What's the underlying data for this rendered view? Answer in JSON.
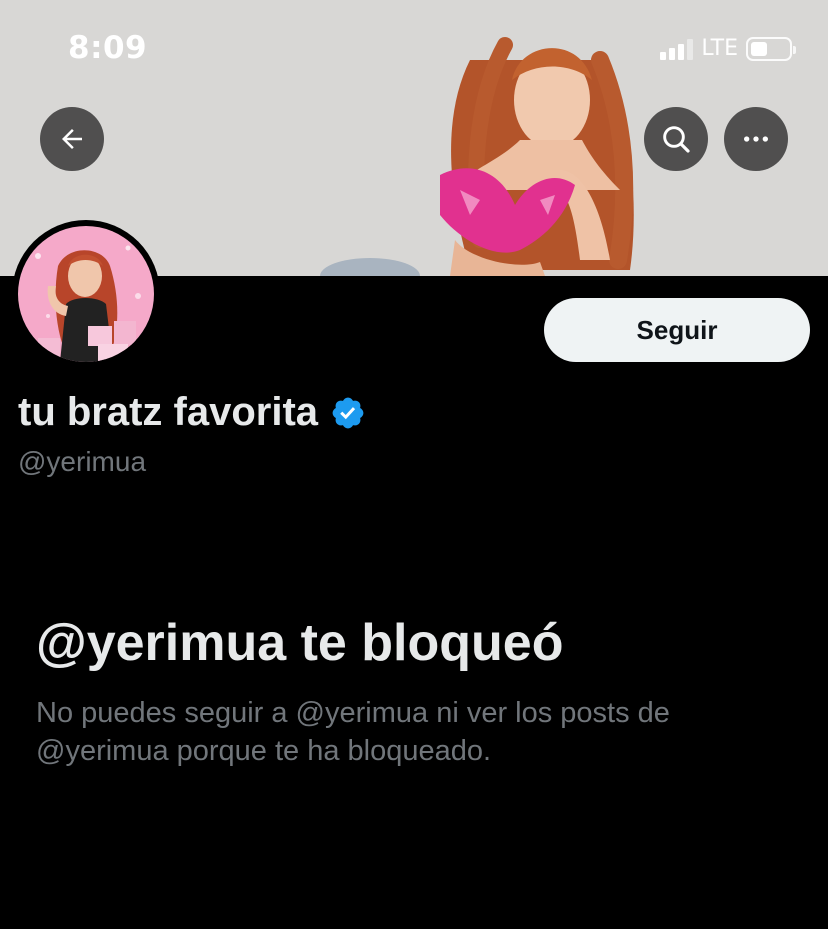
{
  "status_bar": {
    "time": "8:09",
    "network": "LTE",
    "signal_bars_active": 3,
    "signal_bars_total": 4,
    "battery_level": 0.45
  },
  "nav": {
    "back_icon": "arrow-left-icon",
    "search_icon": "search-icon",
    "more_icon": "more-horizontal-icon"
  },
  "profile": {
    "display_name": "tu bratz favorita",
    "verified_icon": "verified-badge-icon",
    "verified_color": "#1d9bf0",
    "handle": "@yerimua"
  },
  "actions": {
    "follow_label": "Seguir"
  },
  "blocked": {
    "title": "@yerimua te bloqueó",
    "description": "No puedes seguir a @yerimua ni ver los posts de @yerimua porque te ha bloqueado."
  },
  "colors": {
    "background": "#000000",
    "text_primary": "#e7e9ea",
    "text_secondary": "#71767b",
    "button_bg": "#eff3f4"
  }
}
